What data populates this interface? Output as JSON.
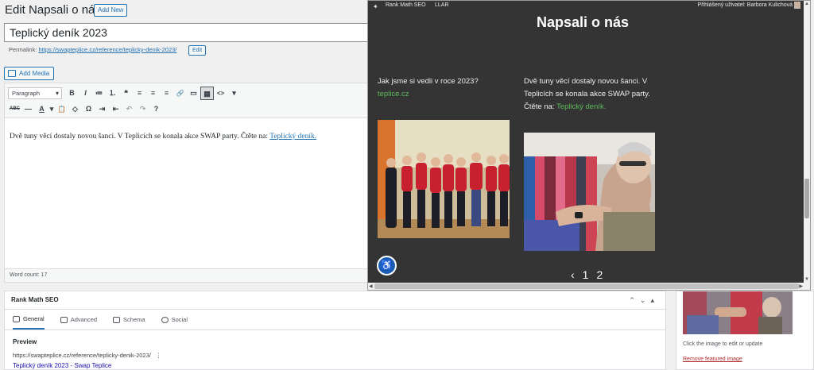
{
  "editor": {
    "page_title": "Edit Napsali o nás",
    "add_new": "Add New",
    "post_title": "Teplický deník 2023",
    "permalink_label": "Permalink:",
    "permalink_url": "https://swapteplice.cz/reference/teplicky-denik-2023/",
    "permalink_edit": "Edit",
    "add_media": "Add Media",
    "format_select": "Paragraph",
    "content_text": "Dvě tuny věcí dostaly novou šanci. V Teplicích se konala akce SWAP party. Čtěte na: ",
    "content_link": "Teplický deník.",
    "word_count": "Word count: 17",
    "toolbar_row1": [
      "B",
      "I",
      "≔",
      "⒈",
      "❝",
      "≡",
      "≡",
      "≡",
      "🔗",
      "▭",
      "▦",
      "<>",
      "▾"
    ],
    "toolbar_row2": [
      "ABC",
      "—",
      "A",
      "▾",
      "📋",
      "◇",
      "Ω",
      "⇥",
      "⇤",
      "↶",
      "↷",
      "?"
    ]
  },
  "rank_math": {
    "box_title": "Rank Math SEO",
    "tabs": [
      "General",
      "Advanced",
      "Schema",
      "Social"
    ],
    "preview_heading": "Preview",
    "preview_url": "https://swapteplice.cz/reference/teplicky-denik-2023/",
    "preview_title_cut": "Teplický deník 2023 - Swap Teplice"
  },
  "featured_image": {
    "note": "Click the image to edit or update",
    "remove": "Remove featured image"
  },
  "preview": {
    "bar_seo": "Rank Math SEO",
    "bar_llar": "LLAR",
    "bar_user": "Přihlášený uživatel: Barbora Kulichová",
    "title": "Napsali o nás",
    "col1_text": "Jak jsme si vedli v roce 2023?",
    "col1_link": "teplice.cz",
    "col2_text": "Dvě tuny věcí dostaly novou šanci. V Teplicích se konala akce SWAP party. Čtěte na: ",
    "col2_link": "Teplický deník.",
    "pager_prev": "‹",
    "pager_1": "1",
    "pager_2": "2"
  },
  "icons": {
    "wordpress": "wordpress-icon",
    "search": "search-icon",
    "accessibility": "accessibility-icon",
    "media": "media-icon"
  },
  "colors": {
    "wp_blue": "#2271b1",
    "preview_bg": "#343434",
    "link_green": "#5cb85c",
    "remove_red": "#b32d2e"
  }
}
